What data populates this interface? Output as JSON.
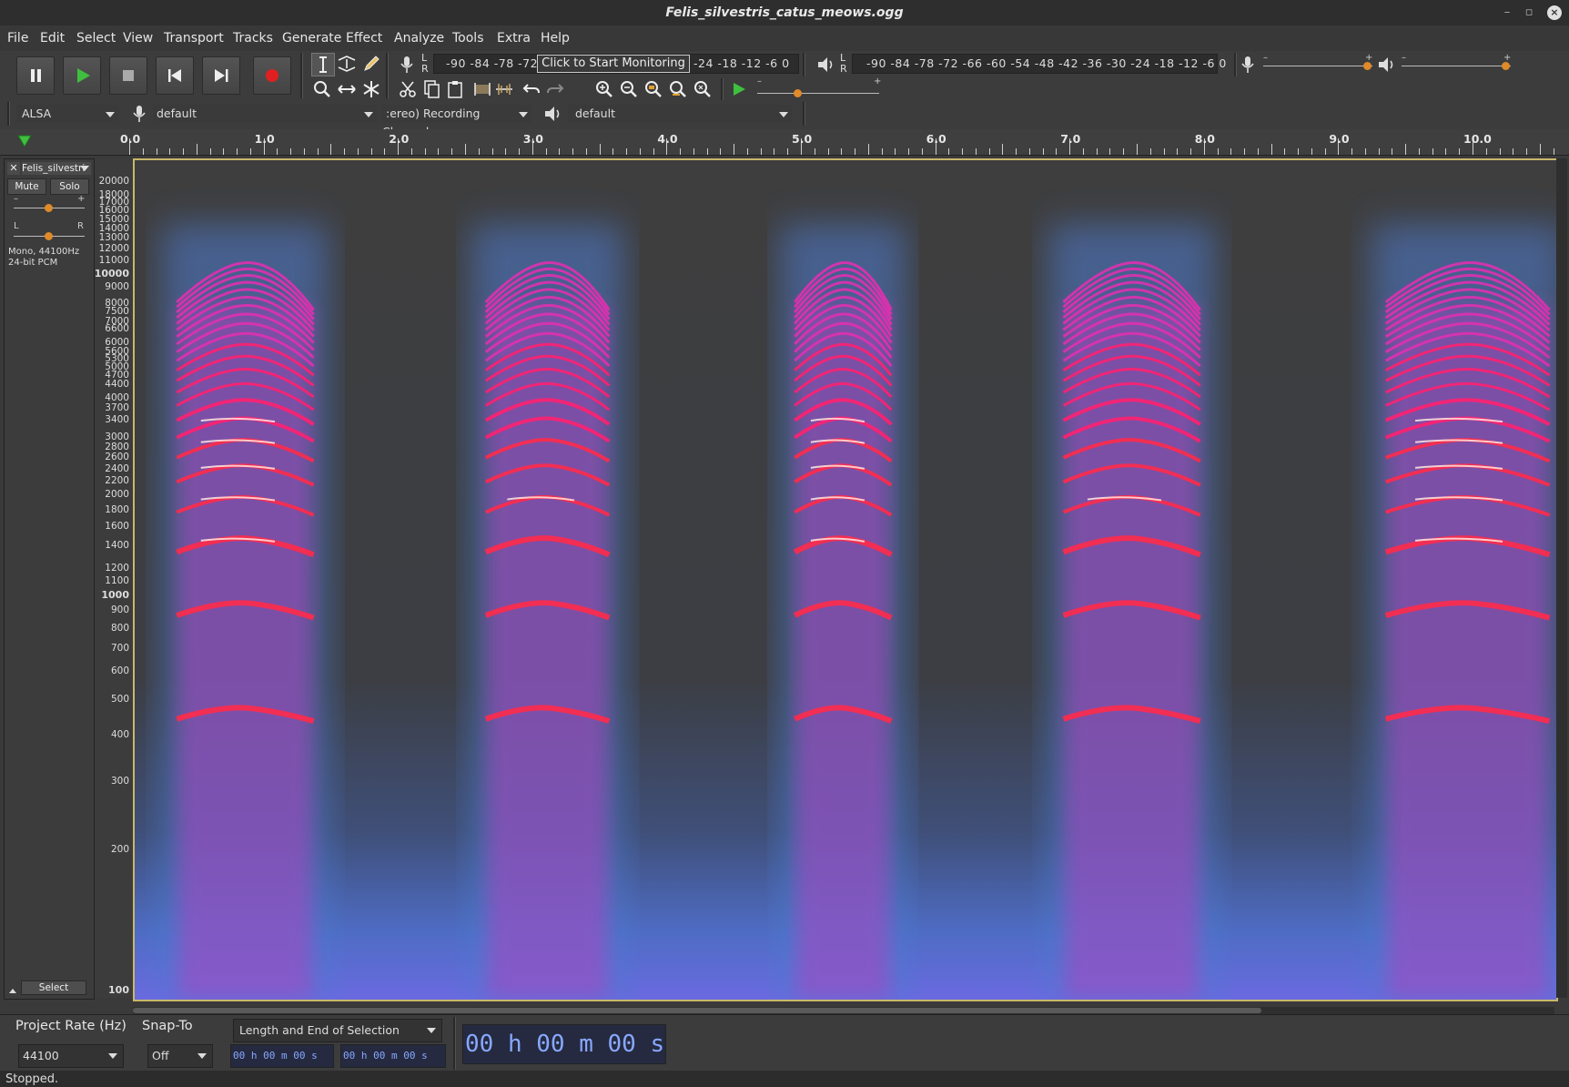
{
  "window": {
    "title": "Felis_silvestris_catus_meows.ogg",
    "minimize": "–",
    "maximize": "▫",
    "close": "×"
  },
  "menu": [
    "File",
    "Edit",
    "Select",
    "View",
    "Transport",
    "Tracks",
    "Generate",
    "Effect",
    "Analyze",
    "Tools",
    "Extra",
    "Help"
  ],
  "meters": {
    "record_scale": "-90 -84 -78 -72",
    "record_scale_tail": "-24 -18 -12  -6  0",
    "monitor_button": "Click to Start Monitoring",
    "playback_scale": "-90 -84 -78 -72 -66 -60 -54 -48 -42 -36 -30 -24 -18 -12  -6  0",
    "lr_top": "L",
    "lr_bottom": "R",
    "record_volume_level": 0.95,
    "playback_volume_level": 0.95,
    "play_at_speed_level": 0.33
  },
  "devices": {
    "host": "ALSA",
    "recording_device": "default",
    "channels": ":ereo) Recording Channels",
    "playback_device": "default"
  },
  "ruler": {
    "labels": [
      "0.0",
      "1.0",
      "2.0",
      "3.0",
      "4.0",
      "5.0",
      "6.0",
      "7.0",
      "8.0",
      "9.0",
      "10.0"
    ],
    "x_seconds": [
      0,
      1,
      2,
      3,
      4,
      5,
      6,
      7,
      8,
      9,
      10
    ]
  },
  "track": {
    "name": "Felis_silvestri",
    "mute": "Mute",
    "solo": "Solo",
    "gain_minus": "–",
    "gain_plus": "+",
    "pan_l": "L",
    "pan_r": "R",
    "info_line1": "Mono, 44100Hz",
    "info_line2": "24-bit PCM",
    "select": "Select",
    "close": "✕"
  },
  "freq_axis": {
    "labels": [
      "20000",
      "18000",
      "17000",
      "16000",
      "15000",
      "14000",
      "13000",
      "12000",
      "11000",
      "10000",
      "9000",
      "8000",
      "7500",
      "7000",
      "6600",
      "6000",
      "5600",
      "5300",
      "5000",
      "4700",
      "4400",
      "4000",
      "3700",
      "3400",
      "3000",
      "2800",
      "2600",
      "2400",
      "2200",
      "2000",
      "1800",
      "1600",
      "1400",
      "1200",
      "1100",
      "1000",
      "900",
      "800",
      "700",
      "600",
      "500",
      "400",
      "300",
      "200",
      "100"
    ],
    "bold": [
      "10000",
      "1000",
      "100"
    ]
  },
  "spectrogram": {
    "meow_start_seconds": [
      0.3,
      2.6,
      4.9,
      6.9,
      9.3
    ],
    "meow_end_seconds": [
      1.4,
      3.6,
      5.7,
      8.0,
      10.6
    ]
  },
  "selection_bar": {
    "project_rate_label": "Project Rate (Hz)",
    "project_rate_value": "44100",
    "snap_to_label": "Snap-To",
    "snap_to_value": "Off",
    "selection_mode": "Length and End of Selection",
    "sel_start": "00 h 00 m 00 s",
    "sel_end": "00 h 00 m 00 s",
    "audio_position": "00 h 00 m 00 s"
  },
  "status": "Stopped.",
  "colors": {
    "track_border": "#c9b76a",
    "record_red": "#e02020",
    "play_green": "#3fbf3f"
  }
}
